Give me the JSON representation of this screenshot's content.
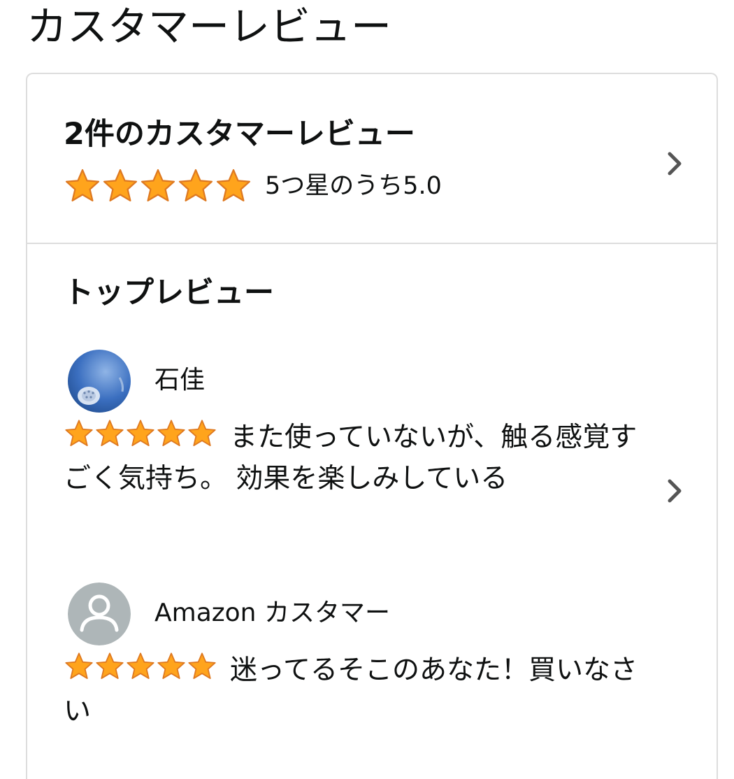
{
  "page": {
    "title": "カスタマーレビュー"
  },
  "summary": {
    "title": "2件のカスタマーレビュー",
    "rating_text": "5つ星のうち5.0",
    "rating": 5.0,
    "rating_max": 5
  },
  "top_reviews": {
    "heading": "トップレビュー",
    "items": [
      {
        "name": "石佳",
        "rating": 5,
        "text": "また使っていないが、触る感覚すごく気持ち。 効果を楽しみしている",
        "avatar": "photo-avatar"
      },
      {
        "name": "Amazon カスタマー",
        "rating": 5,
        "text": "迷ってるそこのあなた！買いなさい",
        "avatar": "default-user-icon"
      }
    ]
  },
  "colors": {
    "star_fill": "#ffa41c",
    "star_stroke": "#de7921",
    "border": "#dddddd",
    "text": "#0f1111",
    "chevron": "#555555"
  }
}
